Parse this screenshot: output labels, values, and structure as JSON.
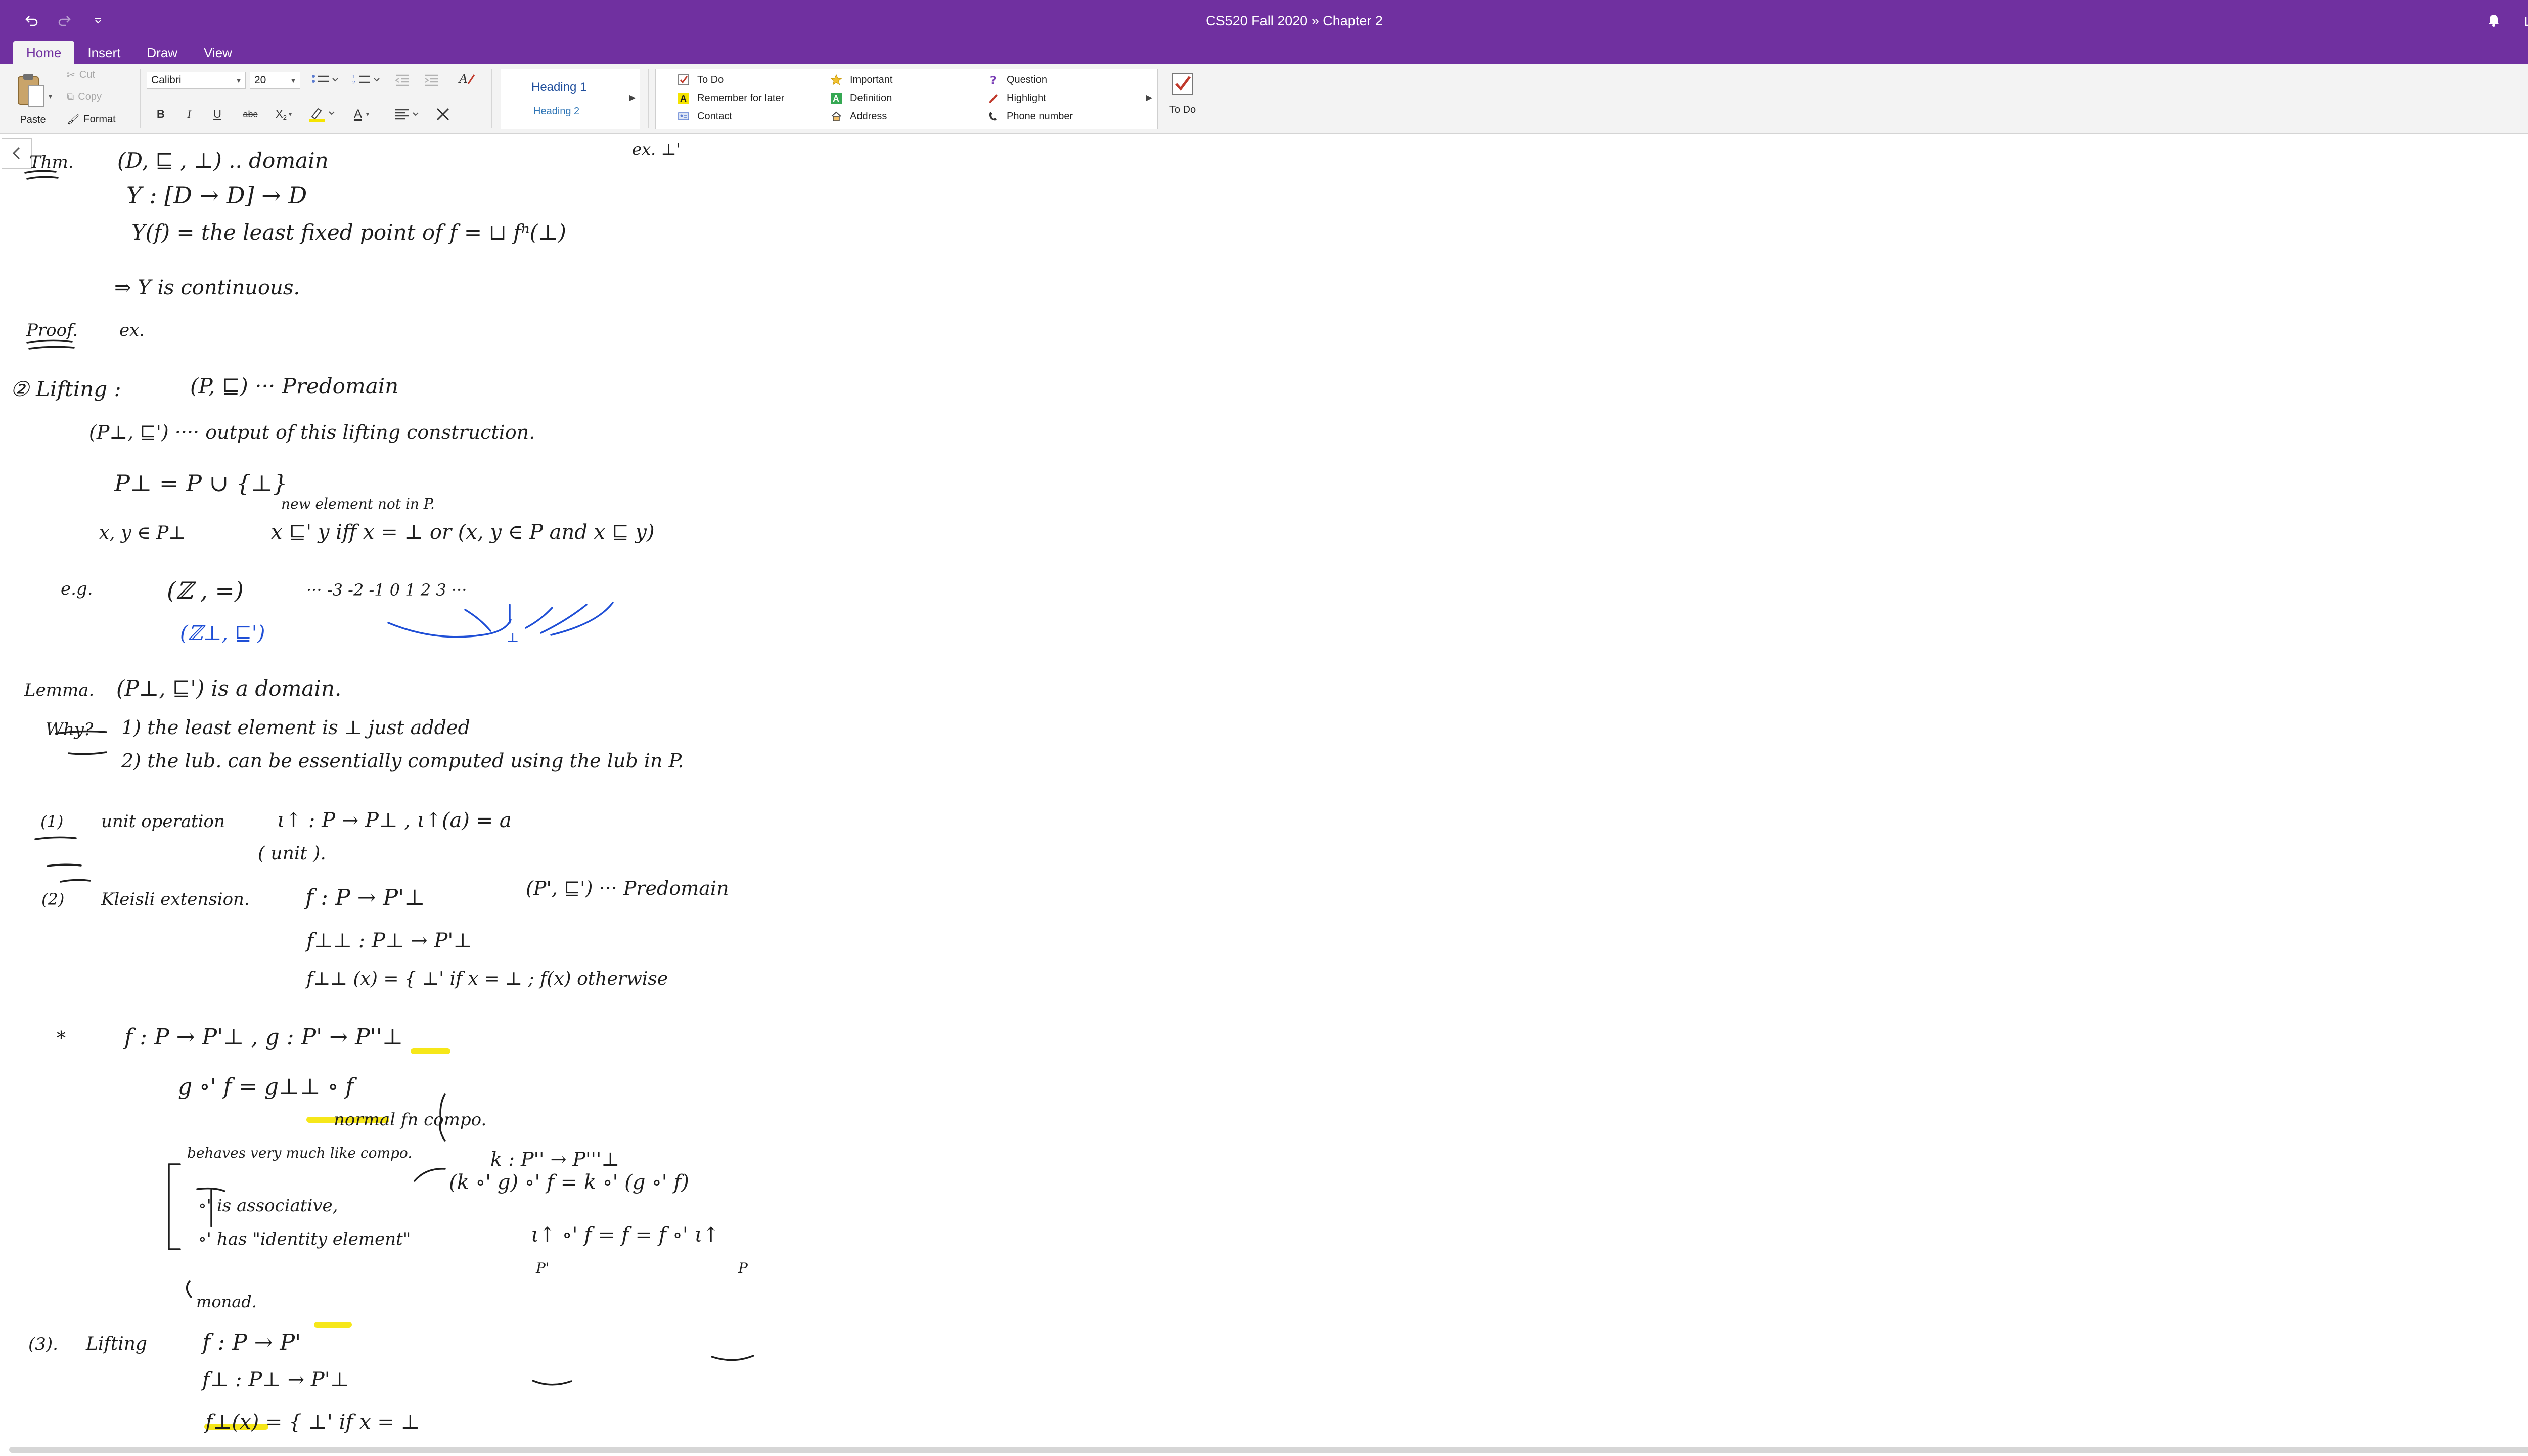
{
  "titlebar": {
    "title": "CS520 Fall 2020  »  Chapter 2",
    "undo_icon": "undo-icon",
    "redo_icon": "redo-icon",
    "customize_icon": "chevron-down-icon",
    "notifications_icon": "bell-icon",
    "share_icon": "share-icon",
    "collapse_icon": "collapse-icon"
  },
  "tabs": [
    {
      "label": "Home",
      "active": true
    },
    {
      "label": "Insert",
      "active": false
    },
    {
      "label": "Draw",
      "active": false
    },
    {
      "label": "View",
      "active": false
    }
  ],
  "clipboard": {
    "paste": "Paste",
    "cut": "Cut",
    "copy": "Copy",
    "format": "Format"
  },
  "font": {
    "family": "Calibri",
    "size": "20",
    "bold": "B",
    "italic": "I",
    "underline": "U",
    "strike": "abc",
    "subscript": "X",
    "subscript_mark": "2",
    "font_color": "A",
    "highlight_color": "#f5e400",
    "font_color_value": "#000000"
  },
  "styles": {
    "heading1": "Heading 1",
    "heading2": "Heading 2"
  },
  "tags": [
    {
      "label": "To Do",
      "icon": "checkbox-icon"
    },
    {
      "label": "Remember for later",
      "icon": "highlighter-a-icon"
    },
    {
      "label": "Contact",
      "icon": "contact-card-icon"
    },
    {
      "label": "Important",
      "icon": "star-icon"
    },
    {
      "label": "Definition",
      "icon": "green-a-icon"
    },
    {
      "label": "Address",
      "icon": "house-icon"
    },
    {
      "label": "Question",
      "icon": "question-icon"
    },
    {
      "label": "Highlight",
      "icon": "pen-icon"
    },
    {
      "label": "Phone number",
      "icon": "phone-icon"
    }
  ],
  "todo": {
    "label": "To Do"
  },
  "colors": {
    "brand": "#7030a0",
    "ink": "#1e1e1e",
    "ink_blue": "#1f4fd6",
    "highlight": "#f5e400"
  },
  "notes": {
    "l01": "Thm.",
    "l02": "(D, ⊑ , ⊥) .. domain",
    "l03": "Y : [D → D] → D",
    "l04": "Y(f) = the least fixed point of f = ⊔ fⁿ(⊥)",
    "l05": "⇒ Y is continuous.",
    "l06": "Proof.",
    "l07": "ex.",
    "l08": "ex. ⊥'",
    "l09": "② Lifting :",
    "l10": "(P, ⊑) ··· Predomain",
    "l11": "(P⊥, ⊑') ···· output of this lifting construction.",
    "l12": "P⊥ = P ∪ {⊥}",
    "l13": "new element not in P.",
    "l14": "x, y ∈ P⊥",
    "l15": "x ⊑' y  iff  x = ⊥  or (x, y ∈ P and x ⊑ y)",
    "l16": "e.g.",
    "l17": "(ℤ , =)",
    "l18": "··· -3  -2  -1  0  1  2  3 ···",
    "l19": "(ℤ⊥, ⊑')",
    "l20": "⊥",
    "l21": "Lemma.",
    "l22": "(P⊥, ⊑') is a domain.",
    "l23": "Why?",
    "l24": "1) the least element is ⊥ just added",
    "l25": "2) the lub. can be essentially computed using the lub in P.",
    "l26": "(1)",
    "l27": "unit operation",
    "l28": "ι↑ : P → P⊥ ,  ι↑(a) = a",
    "l29": "( unit ).",
    "l30": "(2)",
    "l31": "Kleisli extension.",
    "l32": "f : P → P'⊥",
    "l33": "(P', ⊑') ··· Predomain",
    "l34": "f⊥⊥ : P⊥ → P'⊥",
    "l35": "f⊥⊥ (x) = { ⊥'  if x = ⊥ ;  f(x)  otherwise",
    "l36": "*",
    "l37": "f : P → P'⊥ ,  g : P' → P''⊥",
    "l38": "g ∘' f = g⊥⊥ ∘ f",
    "l39": "normal fn compo.",
    "l40": "behaves very much like compo.",
    "l41": "k : P'' → P'''⊥",
    "l42": "∘' is associative,",
    "l43": "(k ∘' g) ∘' f = k ∘' (g ∘' f)",
    "l44": "∘' has \"identity element\"",
    "l45": "ι↑ ∘' f = f = f ∘' ι↑",
    "l46": "P'",
    "l47": "P",
    "l48": "monad.",
    "l49": "(3).",
    "l50": "Lifting",
    "l51": "f : P → P'",
    "l52": "f⊥ : P⊥ → P'⊥",
    "l53": "f⊥(x) = { ⊥'  if x = ⊥"
  }
}
